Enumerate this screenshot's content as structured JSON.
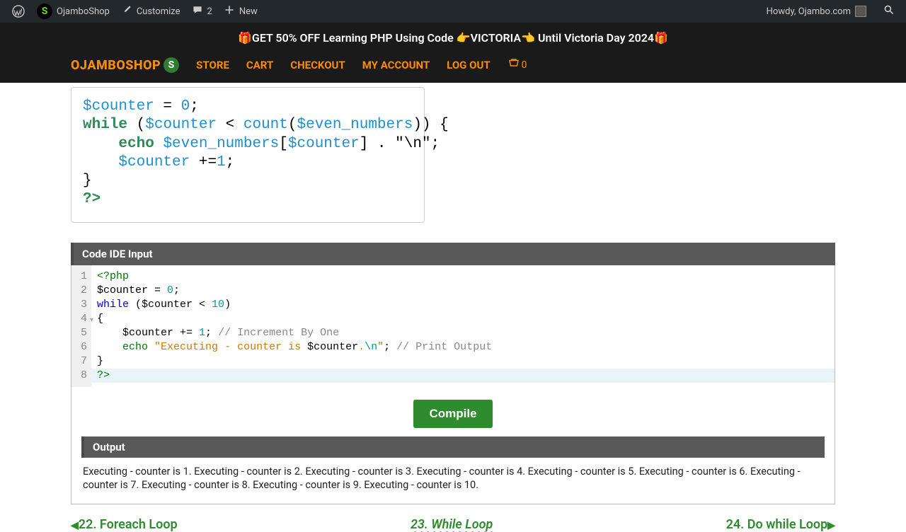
{
  "admin_bar": {
    "site_name": "OjamboShop",
    "customize": "Customize",
    "comments_count": "2",
    "new_label": "New",
    "howdy": "Howdy, Ojambo.com"
  },
  "promo": {
    "gift_left": "🎁",
    "text_a": "GET 50% OFF Learning PHP Using Code ",
    "pointer_l": "👉",
    "code": "VICTORIA",
    "pointer_r": "👈",
    "text_b": " Until Victoria Day 2024",
    "gift_right": "🎁"
  },
  "nav": {
    "brand": "OJAMBOSHOP",
    "brand_badge": "S",
    "items": [
      "STORE",
      "CART",
      "CHECKOUT",
      "MY ACCOUNT",
      "LOG OUT"
    ],
    "cart_count": "0"
  },
  "top_code": {
    "l1_a": "$counter",
    "l1_b": " = ",
    "l1_c": "0",
    "l1_d": ";",
    "l2_a": "while",
    "l2_b": " (",
    "l2_c": "$counter",
    "l2_d": " < ",
    "l2_e": "count",
    "l2_f": "(",
    "l2_g": "$even_numbers",
    "l2_h": ")) {",
    "l3_a": "    ",
    "l3_b": "echo",
    "l3_c": " ",
    "l3_d": "$even_numbers",
    "l3_e": "[",
    "l3_f": "$counter",
    "l3_g": "] . \"\\n\";",
    "l4_a": "    ",
    "l4_b": "$counter",
    "l4_c": " +=",
    "l4_d": "1",
    "l4_e": ";",
    "l5": "}",
    "l6": "?>"
  },
  "ide": {
    "title": "Code IDE Input",
    "gutter": [
      "1",
      "2",
      "3",
      "4",
      "5",
      "6",
      "7",
      "8"
    ],
    "lines": {
      "l1": "<?php",
      "l2_a": "$counter = ",
      "l2_b": "0",
      "l2_c": ";",
      "l3_a": "while",
      "l3_b": " ($counter < ",
      "l3_c": "10",
      "l3_d": ")",
      "l4": "{",
      "l5_a": "    $counter += ",
      "l5_b": "1",
      "l5_c": "; ",
      "l5_d": "// Increment By One",
      "l6_a": "    ",
      "l6_b": "echo",
      "l6_c": " ",
      "l6_d": "\"Executing - counter is ",
      "l6_e": "$counter",
      "l6_f": ".",
      "l6_g": "\\n",
      "l6_h": "\"",
      "l6_i": "; ",
      "l6_j": "// Print Output",
      "l7": "}",
      "l8": "?>"
    }
  },
  "compile_label": "Compile",
  "output": {
    "title": "Output",
    "text": "Executing - counter is 1. Executing - counter is 2. Executing - counter is 3. Executing - counter is 4. Executing - counter is 5. Executing - counter is 6. Executing - counter is 7. Executing - counter is 8. Executing - counter is 9. Executing - counter is 10."
  },
  "pager": {
    "prev": "22. Foreach Loop",
    "current": "23. While Loop",
    "next": "24. Do while Loop"
  }
}
